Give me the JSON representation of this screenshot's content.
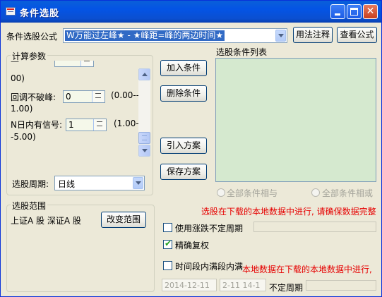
{
  "window": {
    "title": "条件选股",
    "controls": {
      "minimize": "",
      "maximize": "",
      "close": "✕"
    }
  },
  "formula": {
    "label": "条件选股公式",
    "selected": "W万能过左峰★ - ★峰距=峰的两边时间★",
    "usage_button": "用法注释",
    "view_button": "查看公式"
  },
  "params": {
    "group_title": "计算参数",
    "partial_top_label": "—",
    "partial_top_value": "",
    "line0_range": "00)",
    "row1_label": "回调不破峰:",
    "row1_value": "0",
    "row1_range_a": "(0.00--",
    "row1_range_b": "1.00)",
    "row2_label": "N日内有信号:",
    "row2_value": "1",
    "row2_range_a": "(1.00--",
    "row2_range_b": "-5.00)"
  },
  "period": {
    "label": "选股周期:",
    "value": "日线"
  },
  "actions": {
    "add": "加入条件",
    "delete": "删除条件",
    "import": "引入方案",
    "save": "保存方案"
  },
  "condition_list": {
    "label": "选股条件列表"
  },
  "logic": {
    "and_label": "全部条件相与",
    "or_label": "全部条件相或"
  },
  "scope": {
    "group_title": "选股范围",
    "text": "上证A 股  深证A 股",
    "change_button": "改变范围"
  },
  "notice": {
    "local_data": "选股在下载的本地数据中进行, 请确保数据完整",
    "overlap": "本地数据在下载的本地数据中进行,"
  },
  "options": {
    "limit_up_label": "使用涨跌不定周期",
    "precise_label": "精确复权",
    "precise_trailing": "",
    "precise_tail": "",
    "time_range_label": "时间段内满段内满",
    "date_from": "2014-12-11",
    "date_to": "2-11 14-1",
    "no_fixed_period": "不定周期"
  }
}
